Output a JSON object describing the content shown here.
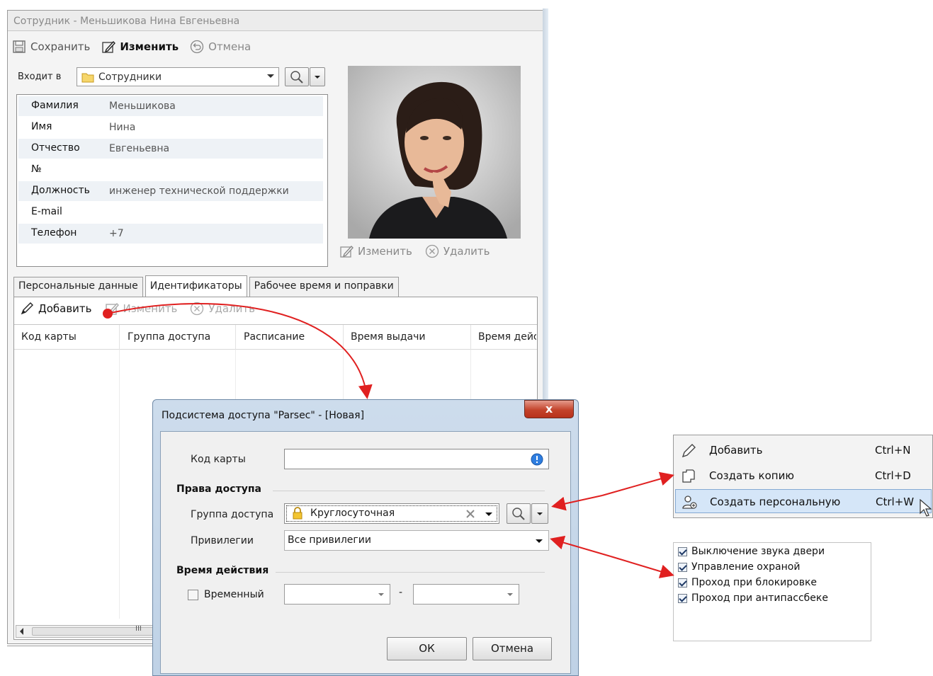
{
  "employee_window": {
    "title": "Сотрудник - Меньшикова Нина Евгеньевна",
    "toolbar": {
      "save_label": "Сохранить",
      "edit_label": "Изменить",
      "cancel_label": "Отмена"
    },
    "belongs_label": "Входит в",
    "belongs_value": "Сотрудники",
    "fields": [
      {
        "label": "Фамилия",
        "value": "Меньшикова"
      },
      {
        "label": "Имя",
        "value": "Нина"
      },
      {
        "label": "Отчество",
        "value": "Евгеньевна"
      },
      {
        "label": "№",
        "value": ""
      },
      {
        "label": "Должность",
        "value": "инженер технической поддержки"
      },
      {
        "label": "E-mail",
        "value": ""
      },
      {
        "label": "Телефон",
        "value": "+7"
      }
    ],
    "photo_actions": {
      "edit_label": "Изменить",
      "delete_label": "Удалить"
    },
    "tabs": [
      "Персональные данные",
      "Идентификаторы",
      "Рабочее время и поправки"
    ],
    "active_tab": "Идентификаторы",
    "id_toolbar": {
      "add_label": "Добавить",
      "edit_label": "Изменить",
      "delete_label": "Удалить"
    },
    "grid_columns": [
      "Код карты",
      "Группа доступа",
      "Расписание",
      "Время выдачи",
      "Время дейс"
    ],
    "scroll_glyph": "III"
  },
  "dialog": {
    "title": "Подсистема доступа \"Parsec\" -  [Новая]",
    "close_label": "x",
    "card_code_label": "Код карты",
    "card_code_value": "",
    "access_rights_title": "Права доступа",
    "access_group_label": "Группа доступа",
    "access_group_value": "Круглосуточная",
    "privileges_label": "Привилегии",
    "privileges_value": "Все привилегии",
    "validity_title": "Время действия",
    "temporary_label": "Временный",
    "temporary_checked": false,
    "range_separator": "-",
    "ok_label": "ОК",
    "cancel_label": "Отмена"
  },
  "context_menu": {
    "items": [
      {
        "label": "Добавить",
        "shortcut": "Ctrl+N",
        "icon": "pencil-icon"
      },
      {
        "label": "Создать копию",
        "shortcut": "Ctrl+D",
        "icon": "copy-icon"
      },
      {
        "label": "Создать персональную",
        "shortcut": "Ctrl+W",
        "icon": "user-icon",
        "highlighted": true
      }
    ]
  },
  "privileges_list": {
    "items": [
      {
        "label": "Выключение звука двери",
        "checked": true
      },
      {
        "label": "Управление охраной",
        "checked": true
      },
      {
        "label": "Проход при блокировке",
        "checked": true
      },
      {
        "label": "Проход при антипассбеке",
        "checked": true
      }
    ]
  },
  "colors": {
    "arrow": "#e02020",
    "menu_highlight": "#d5e6f8",
    "dialog_frame": "#c3d6ea"
  }
}
